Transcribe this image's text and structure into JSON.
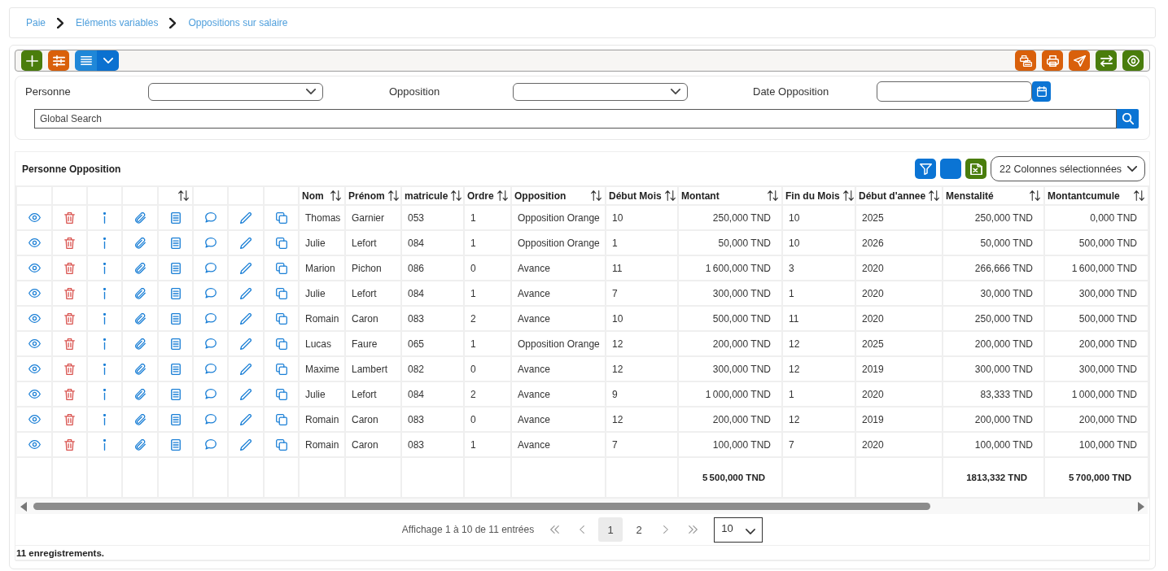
{
  "breadcrumb": [
    {
      "label": "Paie"
    },
    {
      "label": "Eléments variables"
    },
    {
      "label": "Oppositions sur salaire"
    }
  ],
  "toolbar": {
    "left": [
      {
        "kind": "add"
      },
      {
        "kind": "settings"
      },
      {
        "kind": "menu"
      }
    ],
    "right": [
      {
        "kind": "printers"
      },
      {
        "kind": "print"
      },
      {
        "kind": "send"
      },
      {
        "kind": "transfer"
      },
      {
        "kind": "view"
      }
    ]
  },
  "filters": [
    {
      "label": "Personne",
      "kind": "select"
    },
    {
      "label": "Opposition",
      "kind": "select"
    },
    {
      "label": "Date Opposition",
      "kind": "date"
    }
  ],
  "global_search": {
    "placeholder": "Global Search"
  },
  "table": {
    "title": "Personne Opposition",
    "tools": [
      {
        "kind": "filter"
      },
      {
        "kind": "blank"
      },
      {
        "kind": "excel"
      }
    ],
    "column_picker": {
      "value": "22 Colonnes sélectionnées"
    },
    "action_columns": [
      {
        "kind": "view",
        "sortable": false
      },
      {
        "kind": "delete",
        "sortable": false
      },
      {
        "kind": "info",
        "sortable": false
      },
      {
        "kind": "attach",
        "sortable": false
      },
      {
        "kind": "document",
        "sortable": true
      },
      {
        "kind": "comment",
        "sortable": false
      },
      {
        "kind": "edit",
        "sortable": false
      },
      {
        "kind": "copy",
        "sortable": false
      }
    ],
    "columns": [
      {
        "kind": "text",
        "label": "Nom",
        "sortable": true
      },
      {
        "kind": "text",
        "label": "Prénom",
        "sortable": true
      },
      {
        "kind": "text",
        "label": "matricule",
        "sortable": true
      },
      {
        "kind": "text",
        "label": "Ordre",
        "sortable": true
      },
      {
        "kind": "text",
        "label": "Opposition",
        "sortable": true
      },
      {
        "kind": "text",
        "label": "Début Mois",
        "sortable": true
      },
      {
        "kind": "amount",
        "label": "Montant",
        "sortable": true,
        "total": "5 500,000 TND"
      },
      {
        "kind": "text",
        "label": "Fin du Mois",
        "sortable": true
      },
      {
        "kind": "text",
        "label": "Début d'annee",
        "sortable": true
      },
      {
        "kind": "amount",
        "label": "Menstalité",
        "sortable": true,
        "total": "1813,332 TND"
      },
      {
        "kind": "amount",
        "label": "Montantcumule",
        "sortable": true,
        "total": "5 700,000 TND"
      }
    ],
    "rows": [
      {
        "cells": [
          "Thomas",
          "Garnier",
          "053",
          "1",
          "Opposition Orange",
          "10",
          "250,000 TND",
          "10",
          "2025",
          "250,000 TND",
          "0,000 TND"
        ]
      },
      {
        "cells": [
          "Julie",
          "Lefort",
          "084",
          "1",
          "Opposition Orange",
          "1",
          "50,000 TND",
          "10",
          "2026",
          "50,000 TND",
          "500,000 TND"
        ]
      },
      {
        "cells": [
          "Marion",
          "Pichon",
          "086",
          "0",
          "Avance",
          "11",
          "1 600,000 TND",
          "3",
          "2020",
          "266,666 TND",
          "1 600,000 TND"
        ]
      },
      {
        "cells": [
          "Julie",
          "Lefort",
          "084",
          "1",
          "Avance",
          "7",
          "300,000 TND",
          "1",
          "2020",
          "30,000 TND",
          "300,000 TND"
        ]
      },
      {
        "cells": [
          "Romain",
          "Caron",
          "083",
          "2",
          "Avance",
          "10",
          "500,000 TND",
          "11",
          "2020",
          "250,000 TND",
          "500,000 TND"
        ]
      },
      {
        "cells": [
          "Lucas",
          "Faure",
          "065",
          "1",
          "Opposition Orange",
          "12",
          "200,000 TND",
          "12",
          "2025",
          "200,000 TND",
          "200,000 TND"
        ]
      },
      {
        "cells": [
          "Maxime",
          "Lambert",
          "082",
          "0",
          "Avance",
          "12",
          "300,000 TND",
          "12",
          "2019",
          "300,000 TND",
          "300,000 TND"
        ]
      },
      {
        "cells": [
          "Julie",
          "Lefort",
          "084",
          "2",
          "Avance",
          "9",
          "1 000,000 TND",
          "1",
          "2020",
          "83,333 TND",
          "1 000,000 TND"
        ]
      },
      {
        "cells": [
          "Romain",
          "Caron",
          "083",
          "0",
          "Avance",
          "12",
          "200,000 TND",
          "12",
          "2019",
          "200,000 TND",
          "200,000 TND"
        ]
      },
      {
        "cells": [
          "Romain",
          "Caron",
          "083",
          "1",
          "Avance",
          "7",
          "100,000 TND",
          "7",
          "2020",
          "100,000 TND",
          "100,000 TND"
        ]
      }
    ]
  },
  "pagination": {
    "info": "Affichage 1 à 10 de 11 entrées",
    "pages": [
      {
        "label": "1",
        "selected": true
      },
      {
        "label": "2",
        "selected": false
      }
    ],
    "page_size": {
      "value": "10"
    }
  },
  "record_count": "11 enregistrements."
}
